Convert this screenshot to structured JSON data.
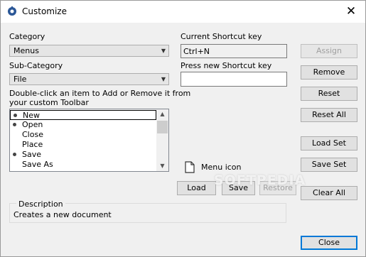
{
  "window": {
    "title": "Customize",
    "close_glyph": "✕",
    "app_icon": "gear-icon"
  },
  "left": {
    "category_label": "Category",
    "category_value": "Menus",
    "subcategory_label": "Sub-Category",
    "subcategory_value": "File",
    "instructions_line1": "Double-click an item to Add or Remove it from",
    "instructions_line2": "your custom Toolbar",
    "items": [
      {
        "label": "New",
        "dot": true,
        "selected": true
      },
      {
        "label": "Open",
        "dot": true,
        "selected": false
      },
      {
        "label": "Close",
        "dot": false,
        "selected": false
      },
      {
        "label": "Place",
        "dot": false,
        "selected": false
      },
      {
        "label": "Save",
        "dot": true,
        "selected": false
      },
      {
        "label": "Save As",
        "dot": false,
        "selected": false
      }
    ],
    "description_label": "Description",
    "description_text": "Creates a new document"
  },
  "middle": {
    "current_shortcut_label": "Current Shortcut key",
    "current_shortcut_value": "Ctrl+N",
    "new_shortcut_label": "Press new Shortcut key",
    "new_shortcut_value": "",
    "menu_icon_label": "Menu icon",
    "load_label": "Load",
    "save_label": "Save",
    "restore_label": "Restore"
  },
  "right": {
    "assign_label": "Assign",
    "remove_label": "Remove",
    "reset_label": "Reset",
    "reset_all_label": "Reset All",
    "load_set_label": "Load Set",
    "save_set_label": "Save Set",
    "clear_all_label": "Clear All",
    "close_label": "Close"
  },
  "watermark": "SOFTPEDIA"
}
